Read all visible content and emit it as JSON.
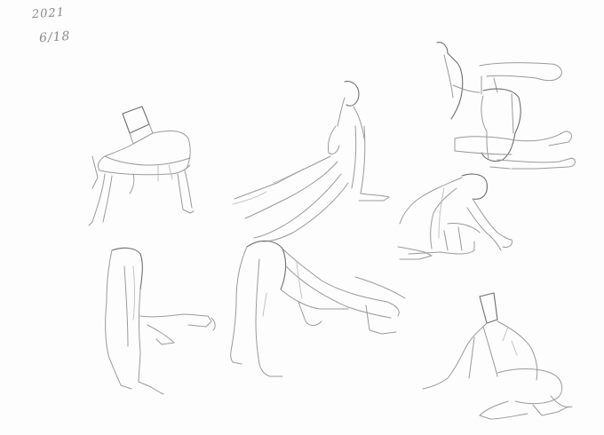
{
  "sketch": {
    "date_year": "2021",
    "date_day": "6/18"
  },
  "colors": {
    "paper": "#fdfdfd",
    "pencil": "#9a9a9a",
    "pencil_dark": "#6e6e6e"
  }
}
